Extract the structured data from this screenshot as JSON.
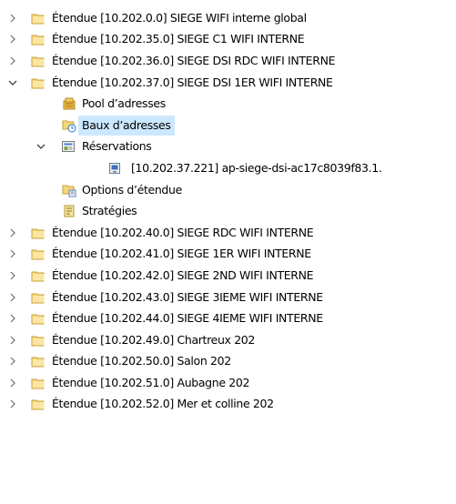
{
  "tree": {
    "items_before": [
      {
        "label": "Étendue [10.202.0.0] SIEGE WIFI interne global"
      },
      {
        "label": "Étendue [10.202.35.0] SIEGE C1 WIFI INTERNE"
      },
      {
        "label": "Étendue [10.202.36.0] SIEGE DSI RDC WIFI INTERNE"
      }
    ],
    "expanded_scope": {
      "label": "Étendue [10.202.37.0] SIEGE DSI 1ER WIFI INTERNE",
      "children": {
        "pool": "Pool d’adresses",
        "leases": "Baux d’adresses",
        "reservations": "Réservations",
        "reservation_item": "[10.202.37.221] ap-siege-dsi-ac17c8039f83.1.",
        "scope_options": "Options d’étendue",
        "policies": "Stratégies"
      }
    },
    "items_after": [
      {
        "label": "Étendue [10.202.40.0] SIEGE RDC WIFI INTERNE"
      },
      {
        "label": "Étendue [10.202.41.0] SIEGE 1ER WIFI INTERNE"
      },
      {
        "label": "Étendue [10.202.42.0] SIEGE 2ND WIFI INTERNE"
      },
      {
        "label": "Étendue [10.202.43.0] SIEGE 3IEME WIFI INTERNE"
      },
      {
        "label": "Étendue [10.202.44.0] SIEGE 4IEME WIFI INTERNE"
      },
      {
        "label": "Étendue [10.202.49.0] Chartreux 202"
      },
      {
        "label": "Étendue [10.202.50.0] Salon 202"
      },
      {
        "label": "Étendue [10.202.51.0] Aubagne 202"
      },
      {
        "label": "Étendue [10.202.52.0] Mer et colline 202"
      }
    ],
    "selected_item": "leases"
  },
  "colors": {
    "selection": "#cce8ff",
    "folder": "#e8c05a",
    "expander": "#6e6e6e"
  },
  "icons": {
    "collapsed": "chevron-right-icon",
    "expanded": "chevron-down-icon",
    "scope": "folder-icon",
    "pool": "address-pool-icon",
    "leases": "address-leases-icon",
    "reservations": "reservations-icon",
    "reservation": "reservation-entry-icon",
    "options": "scope-options-icon",
    "policies": "policies-icon"
  }
}
